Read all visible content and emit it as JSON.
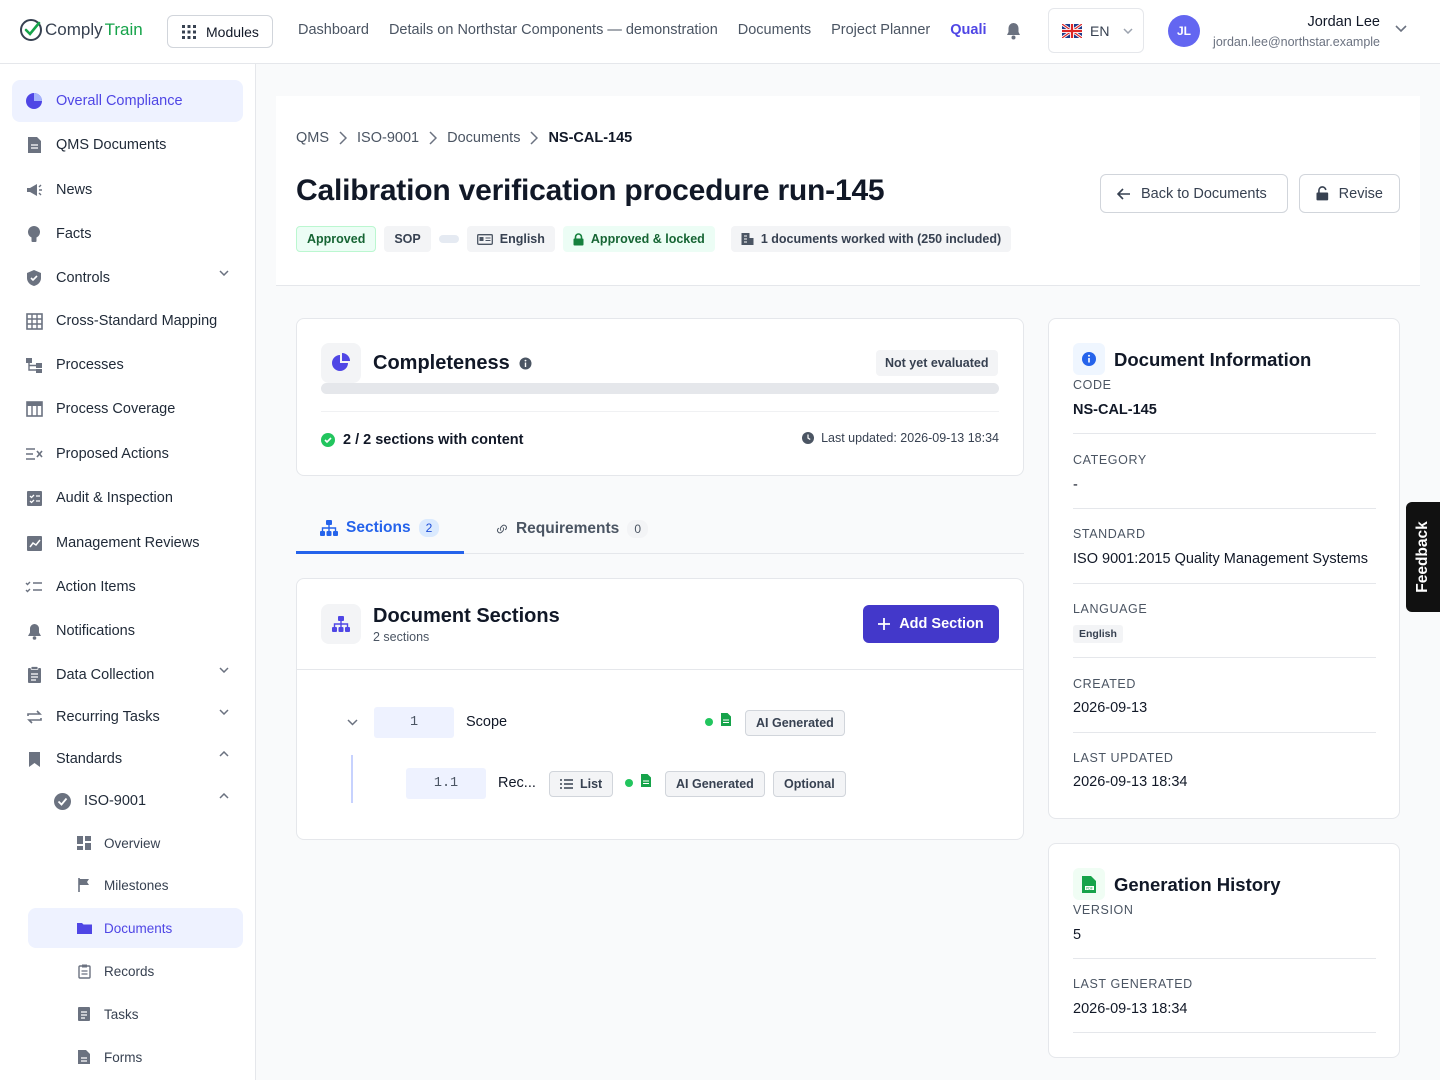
{
  "app": {
    "brand_a": "Comply",
    "brand_b": "Train"
  },
  "topbar": {
    "modules_label": "Modules",
    "nav": [
      "Dashboard",
      "Details on Northstar Components — demonstration",
      "Documents",
      "Project Planner",
      "Quali"
    ],
    "language": "EN",
    "user": {
      "initials": "JL",
      "name": "Jordan Lee",
      "email": "jordan.lee@northstar.example"
    }
  },
  "sidebar": {
    "items": [
      {
        "label": "Overall Compliance",
        "icon": "pie-chart-icon"
      },
      {
        "label": "QMS Documents",
        "icon": "document-icon"
      },
      {
        "label": "News",
        "icon": "megaphone-icon"
      },
      {
        "label": "Facts",
        "icon": "lightbulb-icon"
      },
      {
        "label": "Controls",
        "icon": "shield-check-icon"
      },
      {
        "label": "Cross-Standard Mapping",
        "icon": "grid-icon"
      },
      {
        "label": "Processes",
        "icon": "flow-icon"
      },
      {
        "label": "Process Coverage",
        "icon": "table-icon"
      },
      {
        "label": "Proposed Actions",
        "icon": "list-x-icon"
      },
      {
        "label": "Audit & Inspection",
        "icon": "checklist-box-icon"
      },
      {
        "label": "Management Reviews",
        "icon": "chart-review-icon"
      },
      {
        "label": "Action Items",
        "icon": "list-check-icon"
      },
      {
        "label": "Notifications",
        "icon": "bell-icon"
      },
      {
        "label": "Data Collection",
        "icon": "clipboard-icon"
      },
      {
        "label": "Recurring Tasks",
        "icon": "repeat-icon"
      },
      {
        "label": "Standards",
        "icon": "bookmark-icon"
      }
    ],
    "standard": {
      "label": "ISO-9001",
      "icon": "badge-check-icon"
    },
    "sub_items": [
      {
        "label": "Overview",
        "icon": "dashboard-icon"
      },
      {
        "label": "Milestones",
        "icon": "flag-icon"
      },
      {
        "label": "Documents",
        "icon": "folder-icon"
      },
      {
        "label": "Records",
        "icon": "clipboard-icon"
      },
      {
        "label": "Tasks",
        "icon": "task-icon"
      },
      {
        "label": "Forms",
        "icon": "form-icon"
      }
    ]
  },
  "header": {
    "breadcrumb": [
      "QMS",
      "ISO-9001",
      "Documents",
      "NS-CAL-145"
    ],
    "title": "Calibration verification procedure run-145",
    "badges": {
      "status": "Approved",
      "type": "SOP",
      "language": "English",
      "lock": "Approved & locked",
      "usage": "1 documents worked with (250 included)"
    },
    "back_button": "Back to Documents",
    "revise_button": "Revise"
  },
  "completeness": {
    "title": "Completeness",
    "status": "Not yet evaluated",
    "progress_percent": 0,
    "sections_text": "2 / 2 sections with content",
    "last_updated": "Last updated: 2026-09-13 18:34"
  },
  "tabs": [
    {
      "label": "Sections",
      "count": "2"
    },
    {
      "label": "Requirements",
      "count": "0"
    }
  ],
  "sections_panel": {
    "title": "Document Sections",
    "subtitle": "2 sections",
    "add_button": "Add Section",
    "sections": [
      {
        "number": "1",
        "title": "Scope",
        "tags": [
          "AI Generated"
        ]
      },
      {
        "number": "1.1",
        "title": "Rec...",
        "type": "List",
        "tags": [
          "AI Generated",
          "Optional"
        ]
      }
    ]
  },
  "doc_info": {
    "title": "Document Information",
    "fields": [
      {
        "label": "CODE",
        "value": "NS-CAL-145"
      },
      {
        "label": "CATEGORY",
        "value": "-"
      },
      {
        "label": "STANDARD",
        "value": "ISO 9001:2015 Quality Management Systems"
      },
      {
        "label": "LANGUAGE",
        "value": "English"
      },
      {
        "label": "CREATED",
        "value": "2026-09-13"
      },
      {
        "label": "LAST UPDATED",
        "value": "2026-09-13 18:34"
      }
    ]
  },
  "gen_history": {
    "title": "Generation History",
    "fields": [
      {
        "label": "VERSION",
        "value": "5"
      },
      {
        "label": "LAST GENERATED",
        "value": "2026-09-13 18:34"
      }
    ]
  },
  "feedback_label": "Feedback",
  "colors": {
    "accent": "#4f46e5",
    "primary_button": "#4338ca",
    "tab_active": "#2563eb",
    "success": "#22c55e"
  }
}
